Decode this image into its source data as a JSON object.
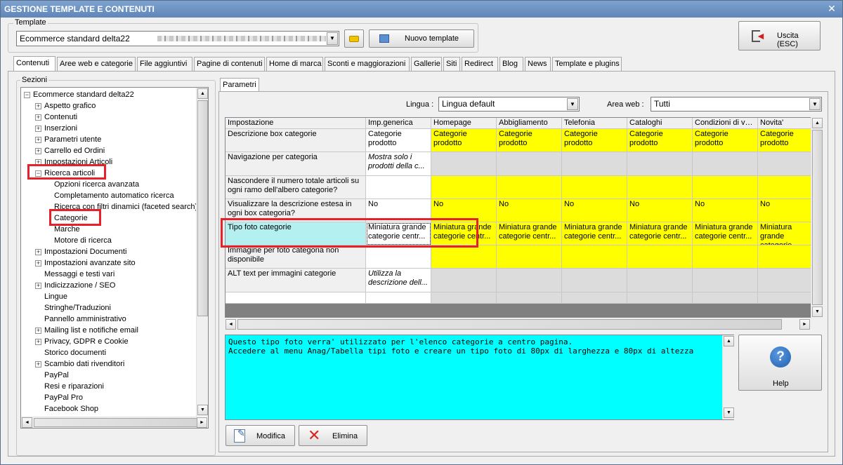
{
  "window": {
    "title": "GESTIONE TEMPLATE E CONTENUTI"
  },
  "template_group": {
    "label": "Template",
    "selected": "Ecommerce standard delta22",
    "new_button": "Nuovo template"
  },
  "exit_button": "Uscita (ESC)",
  "tabs": [
    {
      "label": "Contenuti"
    },
    {
      "label": "Aree web e categorie"
    },
    {
      "label": "File aggiuntivi"
    },
    {
      "label": "Pagine di contenuti"
    },
    {
      "label": "Home di marca"
    },
    {
      "label": "Sconti e maggiorazioni"
    },
    {
      "label": "Gallerie"
    },
    {
      "label": "Siti"
    },
    {
      "label": "Redirect"
    },
    {
      "label": "Blog"
    },
    {
      "label": "News"
    },
    {
      "label": "Template e plugins"
    }
  ],
  "sections": {
    "label": "Sezioni",
    "items": [
      {
        "label": "Ecommerce standard delta22",
        "exp": "−",
        "level": 0
      },
      {
        "label": "Aspetto grafico",
        "exp": "+",
        "level": 1
      },
      {
        "label": "Contenuti",
        "exp": "+",
        "level": 1
      },
      {
        "label": "Inserzioni",
        "exp": "+",
        "level": 1
      },
      {
        "label": "Parametri utente",
        "exp": "+",
        "level": 1
      },
      {
        "label": "Carrello ed Ordini",
        "exp": "+",
        "level": 1
      },
      {
        "label": "Impostazioni Articoli",
        "exp": "+",
        "level": 1
      },
      {
        "label": "Ricerca articoli",
        "exp": "−",
        "level": 1
      },
      {
        "label": "Opzioni ricerca avanzata",
        "exp": "",
        "level": 2
      },
      {
        "label": "Completamento automatico ricerca",
        "exp": "",
        "level": 2
      },
      {
        "label": "Ricerca con filtri dinamici (faceted search)",
        "exp": "",
        "level": 2
      },
      {
        "label": "Categorie",
        "exp": "",
        "level": 2
      },
      {
        "label": "Marche",
        "exp": "",
        "level": 2
      },
      {
        "label": "Motore di ricerca",
        "exp": "",
        "level": 2
      },
      {
        "label": "Impostazioni Documenti",
        "exp": "+",
        "level": 1
      },
      {
        "label": "Impostazioni avanzate sito",
        "exp": "+",
        "level": 1
      },
      {
        "label": "Messaggi e testi vari",
        "exp": "",
        "level": 1
      },
      {
        "label": "Indicizzazione / SEO",
        "exp": "+",
        "level": 1
      },
      {
        "label": "Lingue",
        "exp": "",
        "level": 1
      },
      {
        "label": "Stringhe/Traduzioni",
        "exp": "",
        "level": 1
      },
      {
        "label": "Pannello amministrativo",
        "exp": "",
        "level": 1
      },
      {
        "label": "Mailing list e notifiche email",
        "exp": "+",
        "level": 1
      },
      {
        "label": "Privacy, GDPR e Cookie",
        "exp": "+",
        "level": 1
      },
      {
        "label": "Storico documenti",
        "exp": "",
        "level": 1
      },
      {
        "label": "Scambio dati rivenditori",
        "exp": "+",
        "level": 1
      },
      {
        "label": "PayPal",
        "exp": "",
        "level": 1
      },
      {
        "label": "Resi e riparazioni",
        "exp": "",
        "level": 1
      },
      {
        "label": "PayPal Pro",
        "exp": "",
        "level": 1
      },
      {
        "label": "Facebook Shop",
        "exp": "",
        "level": 1
      }
    ]
  },
  "params_tab": "Parametri",
  "filters": {
    "lingua_label": "Lingua :",
    "lingua_value": "Lingua default",
    "area_label": "Area web :",
    "area_value": "Tutti"
  },
  "grid": {
    "columns": [
      "Impostazione",
      "Imp.generica",
      "Homepage",
      "Abbigliamento",
      "Telefonia",
      "Cataloghi",
      "Condizioni di ve...",
      "Novita'"
    ],
    "rows": [
      {
        "cells": [
          "Descrizione box categorie",
          "Categorie prodotto",
          "Categorie prodotto",
          "Categorie prodotto",
          "Categorie prodotto",
          "Categorie prodotto",
          "Categorie prodotto",
          "Categorie prodotto"
        ],
        "yellow": true,
        "italic": false
      },
      {
        "cells": [
          "Navigazione per categoria",
          "Mostra solo i prodotti della c...",
          "",
          "",
          "",
          "",
          "",
          ""
        ],
        "yellow": false,
        "italic": true
      },
      {
        "cells": [
          "Nascondere il numero totale articoli su ogni ramo dell'albero categorie?",
          "",
          "",
          "",
          "",
          "",
          "",
          ""
        ],
        "yellow": true,
        "italic": false
      },
      {
        "cells": [
          "Visualizzare la descrizione estesa in ogni box categoria?",
          "No",
          "No",
          "No",
          "No",
          "No",
          "No",
          "No"
        ],
        "yellow": true,
        "italic": false
      },
      {
        "cells": [
          "Tipo foto categorie",
          "Miniatura grande categorie centr...",
          "Miniatura grande categorie centr...",
          "Miniatura grande categorie centr...",
          "Miniatura grande categorie centr...",
          "Miniatura grande categorie centr...",
          "Miniatura grande categorie centr...",
          "Miniatura grande categorie centr..."
        ],
        "yellow": true,
        "italic": false,
        "selected": true
      },
      {
        "cells": [
          "Immagine per foto categoria non disponibile",
          "",
          "",
          "",
          "",
          "",
          "",
          ""
        ],
        "yellow": true,
        "italic": false
      },
      {
        "cells": [
          "ALT text per immagini categorie",
          "Utilizza la descrizione dell...",
          "",
          "",
          "",
          "",
          "",
          ""
        ],
        "yellow": false,
        "italic": true
      }
    ]
  },
  "description": {
    "line1": "Questo tipo foto verra' utilizzato per l'elenco categorie a centro pagina.",
    "line2": "Accedere al menu Anag/Tabella tipi foto e creare un tipo foto di 80px di larghezza e 80px di altezza"
  },
  "buttons": {
    "help": "Help",
    "modifica": "Modifica",
    "elimina": "Elimina"
  },
  "colors": {
    "yellow": "#ffff00",
    "cyan": "#00ffff",
    "selected_row": "#b4f0f0",
    "highlight": "#e8202a"
  }
}
